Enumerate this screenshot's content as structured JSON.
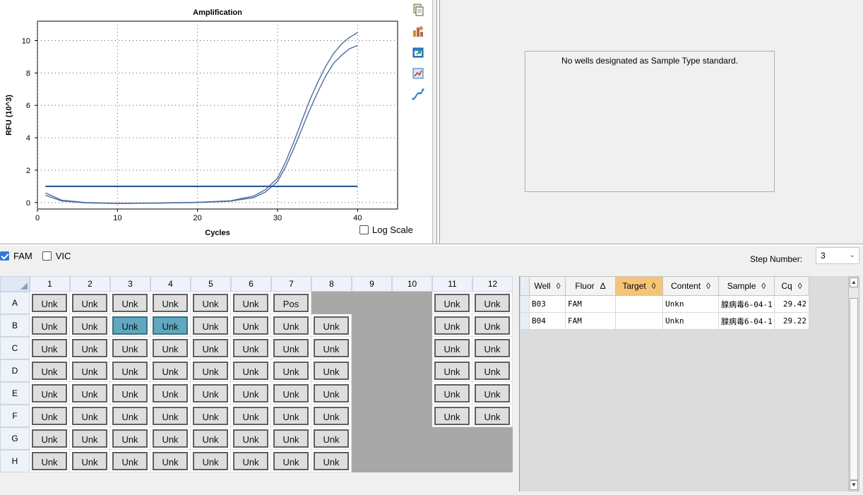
{
  "chart_data": {
    "type": "line",
    "title": "Amplification",
    "xlabel": "Cycles",
    "ylabel": "RFU (10^3)",
    "xlim": [
      0,
      45
    ],
    "ylim": [
      -0.4,
      11.2
    ],
    "x_ticks": [
      0,
      10,
      20,
      30,
      40
    ],
    "y_ticks": [
      0,
      2,
      4,
      6,
      8,
      10
    ],
    "grid": true,
    "threshold": 1.0,
    "series": [
      {
        "x": [
          1,
          3,
          6,
          10,
          15,
          20,
          24,
          27,
          28.5,
          30,
          31,
          32,
          33,
          34,
          35,
          36,
          37,
          38,
          39,
          40
        ],
        "values": [
          0.6,
          0.15,
          0.0,
          -0.05,
          -0.03,
          0.02,
          0.1,
          0.4,
          0.8,
          1.5,
          2.5,
          3.7,
          5.0,
          6.3,
          7.4,
          8.4,
          9.2,
          9.8,
          10.2,
          10.5
        ]
      },
      {
        "x": [
          1,
          3,
          6,
          10,
          15,
          20,
          24,
          27,
          28.5,
          30,
          31,
          32,
          33,
          34,
          35,
          36,
          37,
          38,
          39,
          40
        ],
        "values": [
          0.45,
          0.1,
          -0.02,
          -0.06,
          -0.04,
          0.0,
          0.08,
          0.3,
          0.65,
          1.3,
          2.2,
          3.3,
          4.5,
          5.7,
          6.8,
          7.8,
          8.6,
          9.1,
          9.5,
          9.7
        ]
      }
    ],
    "colors": {
      "series": "#4d6e9c",
      "threshold": "#1e4f8a"
    }
  },
  "chart_controls": {
    "log_scale_label": "Log Scale",
    "log_scale_checked": false
  },
  "side_icons": [
    "copy-icon",
    "chart-tools-icon",
    "export-icon",
    "zoom-icon",
    "curve-icon"
  ],
  "std_curve": {
    "message": "No wells designated as Sample Type standard."
  },
  "fluors": [
    {
      "label": "FAM",
      "checked": true
    },
    {
      "label": "VIC",
      "checked": false
    }
  ],
  "step": {
    "label": "Step Number:",
    "value": "3"
  },
  "plate": {
    "columns": [
      "1",
      "2",
      "3",
      "4",
      "5",
      "6",
      "7",
      "8",
      "9",
      "10",
      "11",
      "12"
    ],
    "rows": [
      {
        "label": "A",
        "cells": [
          "Unk",
          "Unk",
          "Unk",
          "Unk",
          "Unk",
          "Unk",
          "Pos",
          "",
          "",
          "",
          "Unk",
          "Unk"
        ]
      },
      {
        "label": "B",
        "cells": [
          "Unk",
          "Unk",
          "Unk",
          "Unk",
          "Unk",
          "Unk",
          "Unk",
          "Unk",
          "",
          "",
          "Unk",
          "Unk"
        ]
      },
      {
        "label": "C",
        "cells": [
          "Unk",
          "Unk",
          "Unk",
          "Unk",
          "Unk",
          "Unk",
          "Unk",
          "Unk",
          "",
          "",
          "Unk",
          "Unk"
        ]
      },
      {
        "label": "D",
        "cells": [
          "Unk",
          "Unk",
          "Unk",
          "Unk",
          "Unk",
          "Unk",
          "Unk",
          "Unk",
          "",
          "",
          "Unk",
          "Unk"
        ]
      },
      {
        "label": "E",
        "cells": [
          "Unk",
          "Unk",
          "Unk",
          "Unk",
          "Unk",
          "Unk",
          "Unk",
          "Unk",
          "",
          "",
          "Unk",
          "Unk"
        ]
      },
      {
        "label": "F",
        "cells": [
          "Unk",
          "Unk",
          "Unk",
          "Unk",
          "Unk",
          "Unk",
          "Unk",
          "Unk",
          "",
          "",
          "Unk",
          "Unk"
        ]
      },
      {
        "label": "G",
        "cells": [
          "Unk",
          "Unk",
          "Unk",
          "Unk",
          "Unk",
          "Unk",
          "Unk",
          "Unk",
          "",
          "",
          "",
          ""
        ]
      },
      {
        "label": "H",
        "cells": [
          "Unk",
          "Unk",
          "Unk",
          "Unk",
          "Unk",
          "Unk",
          "Unk",
          "Unk",
          "",
          "",
          "",
          ""
        ]
      }
    ],
    "selected": [
      "B3",
      "B4"
    ]
  },
  "results": {
    "headers": [
      {
        "label": "Well",
        "sort": "◊"
      },
      {
        "label": "Fluor",
        "sort": "Δ"
      },
      {
        "label": "Target",
        "sort": "◊",
        "highlight": true
      },
      {
        "label": "Content",
        "sort": "◊"
      },
      {
        "label": "Sample",
        "sort": "◊"
      },
      {
        "label": "Cq",
        "sort": "◊"
      }
    ],
    "rows": [
      {
        "well": "B03",
        "fluor": "FAM",
        "target": "",
        "content": "Unkn",
        "sample": "腺病毒6-04-1",
        "cq": "29.42"
      },
      {
        "well": "B04",
        "fluor": "FAM",
        "target": "",
        "content": "Unkn",
        "sample": "腺病毒6-04-1",
        "cq": "29.22"
      }
    ]
  }
}
